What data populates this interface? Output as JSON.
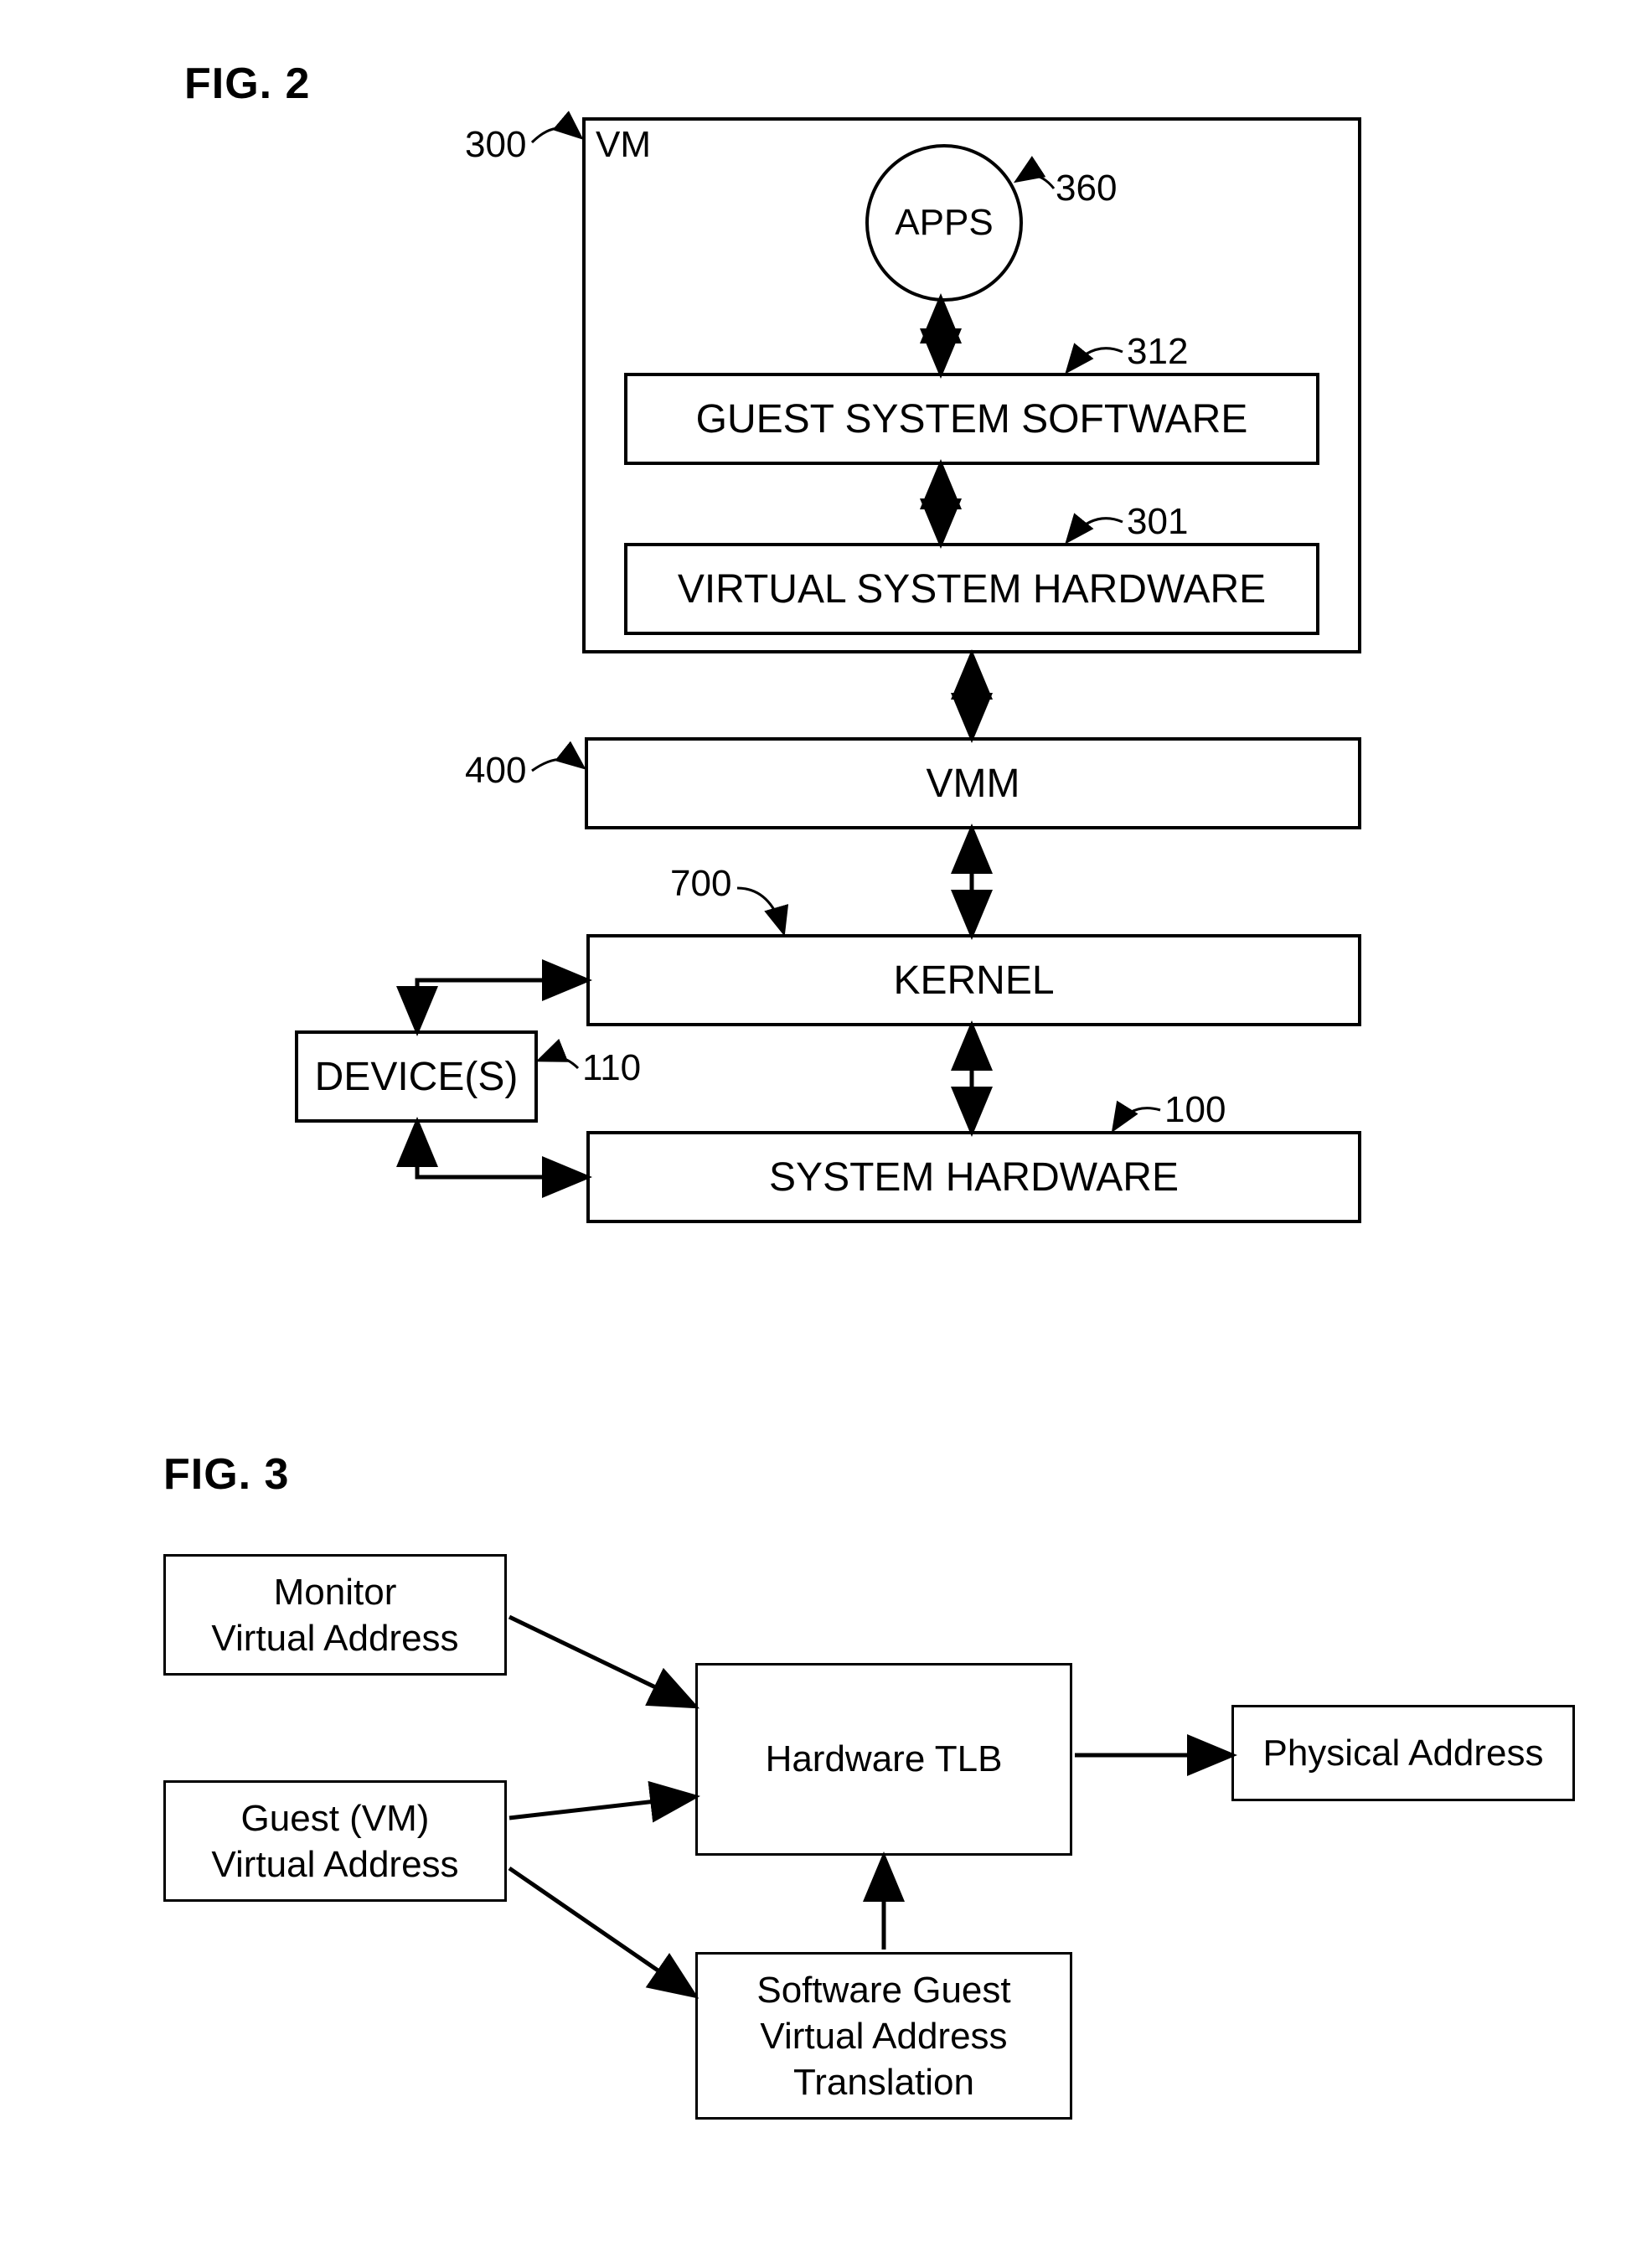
{
  "fig2": {
    "title": "FIG. 2",
    "vm": {
      "corner": "VM",
      "ref": "300"
    },
    "apps": {
      "label": "APPS",
      "ref": "360"
    },
    "gss": {
      "label": "GUEST SYSTEM SOFTWARE",
      "ref": "312"
    },
    "vsh": {
      "label": "VIRTUAL SYSTEM HARDWARE",
      "ref": "301"
    },
    "vmm": {
      "label": "VMM",
      "ref": "400"
    },
    "kernel": {
      "label": "KERNEL",
      "ref": "700"
    },
    "devices": {
      "label": "DEVICE(S)",
      "ref": "110"
    },
    "syshw": {
      "label": "SYSTEM HARDWARE",
      "ref": "100"
    }
  },
  "fig3": {
    "title": "FIG. 3",
    "mva": "Monitor\nVirtual Address",
    "gva": "Guest (VM)\nVirtual Address",
    "tlb": "Hardware TLB",
    "sgvat": "Software Guest\nVirtual Address\nTranslation",
    "pa": "Physical Address"
  }
}
